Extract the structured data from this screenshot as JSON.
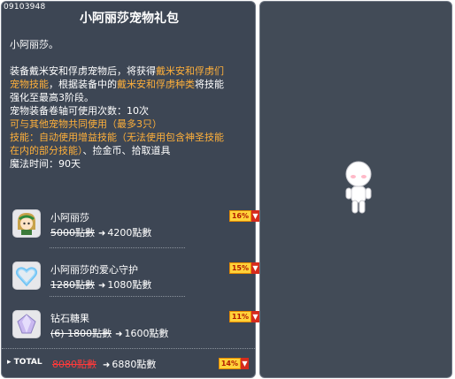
{
  "item_id": "09103948",
  "title": "小阿丽莎宠物礼包",
  "desc": {
    "name_line": "小阿丽莎。",
    "l1_a": "装备戴米安和俘虏宠物后，将获得",
    "l1_b": "戴米安和俘虏们",
    "l2_a": "宠物技能",
    "l2_b": "，根据装备中的",
    "l2_c": "戴米安和俘虏种类",
    "l2_d": "将技能",
    "l3": "强化至最高3阶段。",
    "l4": "宠物装备卷轴可使用次数：10次",
    "l5": "可与其他宠物共同使用（最多3只）",
    "l6": "技能：自动使用增益技能（无法使用包含神圣技能",
    "l7_a": "在内的部分技能）",
    "l7_b": "、捡金币、拾取道具",
    "l8": "魔法时间：90天"
  },
  "products": [
    {
      "name": "小阿丽莎",
      "old_price": "5000點數",
      "new_price": "4200點數",
      "discount": "16%",
      "icon": "alisa-doll-icon"
    },
    {
      "name": "小阿丽莎的爱心守护",
      "old_price": "1280點數",
      "new_price": "1080點數",
      "discount": "15%",
      "icon": "heart-guard-icon"
    },
    {
      "name": "钻石糖果",
      "old_price": "(6) 1800點數",
      "new_price": "1600點數",
      "discount": "11%",
      "icon": "diamond-candy-icon"
    }
  ],
  "total": {
    "label": "TOTAL",
    "old_price": "8080點數",
    "new_price": "6880點數",
    "discount": "14%"
  },
  "colors": {
    "panel": "#3d4654",
    "highlight": "#ffb03a",
    "total_old": "#ff3a3a",
    "badge": "#ffd23a"
  }
}
